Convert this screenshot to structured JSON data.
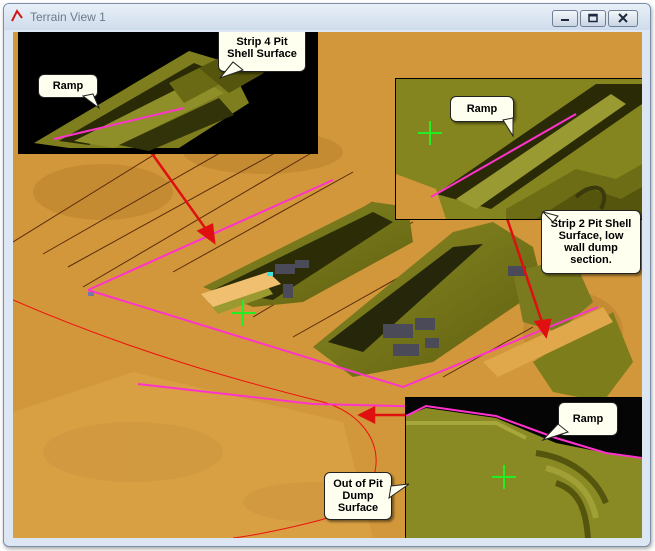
{
  "window": {
    "title": "Terrain View 1",
    "buttons": [
      "minimize",
      "maximize",
      "close"
    ]
  },
  "callouts": {
    "strip4": "Strip 4 Pit\nShell Surface",
    "ramp1": "Ramp",
    "ramp2": "Ramp",
    "strip2": "Strip 2 Pit Shell\nSurface, low\nwall dump\nsection.",
    "ramp3": "Ramp",
    "dump": "Out of Pit\nDump\nSurface"
  },
  "colors": {
    "terrain": "#d2973a",
    "shell": "#7d7d1c",
    "ramp": "#ff33cc",
    "arrow": "#e01010",
    "cursor": "#22ee22",
    "boundary": "#ee1111"
  }
}
